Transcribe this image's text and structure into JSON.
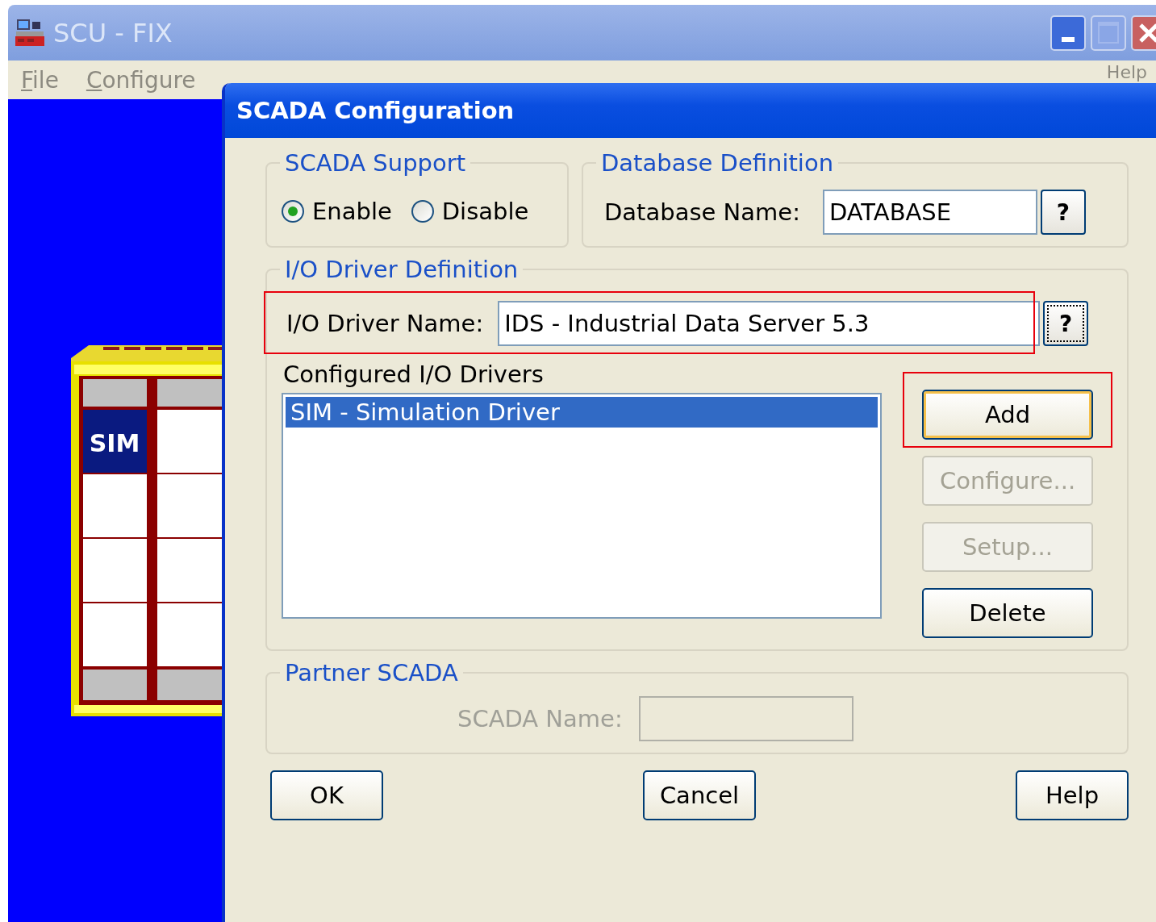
{
  "window": {
    "title": "SCU - FIX",
    "active": false
  },
  "menu": [
    {
      "label": "File",
      "mnemonic": true
    },
    {
      "label": "Configure",
      "mnemonic": true
    },
    {
      "label": "Help",
      "mnemonic": false
    }
  ],
  "rack": {
    "slots": [
      {
        "label": "SIM",
        "selected": true
      }
    ]
  },
  "dialog": {
    "title": "SCADA Configuration",
    "scada_support": {
      "title": "SCADA Support",
      "options": [
        {
          "label": "Enable",
          "selected": true
        },
        {
          "label": "Disable",
          "selected": false
        }
      ]
    },
    "database": {
      "title": "Database Definition",
      "label": "Database Name:",
      "value": "DATABASE",
      "help": "?"
    },
    "io_driver": {
      "title": "I/O Driver Definition",
      "label": "I/O Driver Name:",
      "value": "IDS - Industrial Data Server 5.3",
      "help": "?",
      "highlighted": true,
      "list_label": "Configured I/O Drivers",
      "drivers": [
        {
          "label": "SIM - Simulation Driver",
          "selected": true
        }
      ],
      "buttons": [
        {
          "label": "Add",
          "disabled": false,
          "highlighted": true
        },
        {
          "label": "Configure...",
          "disabled": true,
          "highlighted": false
        },
        {
          "label": "Setup...",
          "disabled": true,
          "highlighted": false
        },
        {
          "label": "Delete",
          "disabled": false,
          "highlighted": false
        }
      ]
    },
    "partner": {
      "title": "Partner SCADA",
      "label": "SCADA Name:",
      "disabled": true
    },
    "buttons": [
      {
        "label": "OK"
      },
      {
        "label": "Cancel"
      },
      {
        "label": "Help"
      }
    ]
  }
}
